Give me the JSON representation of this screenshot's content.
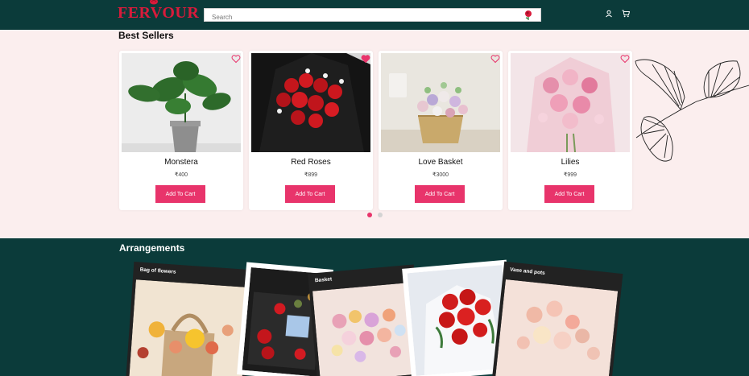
{
  "brand": {
    "name": "FERVOUR",
    "color": "#d81b3b"
  },
  "search": {
    "placeholder": "Search"
  },
  "header_icons": [
    "user-icon",
    "cart-icon"
  ],
  "best_sellers": {
    "title": "Best Sellers",
    "products": [
      {
        "name": "Monstera",
        "price": "₹400",
        "button": "Add To Cart"
      },
      {
        "name": "Red Roses",
        "price": "₹899",
        "button": "Add To Cart"
      },
      {
        "name": "Love Basket",
        "price": "₹3000",
        "button": "Add To Cart"
      },
      {
        "name": "Lilies",
        "price": "₹999",
        "button": "Add To Cart"
      }
    ],
    "carousel": {
      "pages": 2,
      "active": 1
    }
  },
  "arrangements": {
    "title": "Arrangements",
    "items": [
      {
        "label": "Bag of flowers"
      },
      {
        "label": ""
      },
      {
        "label": "Basket"
      },
      {
        "label": ""
      },
      {
        "label": "Vase and pots"
      }
    ]
  },
  "colors": {
    "header_bg": "#0b3b3a",
    "accent": "#e8346b",
    "page_bg": "#fbeeee"
  }
}
